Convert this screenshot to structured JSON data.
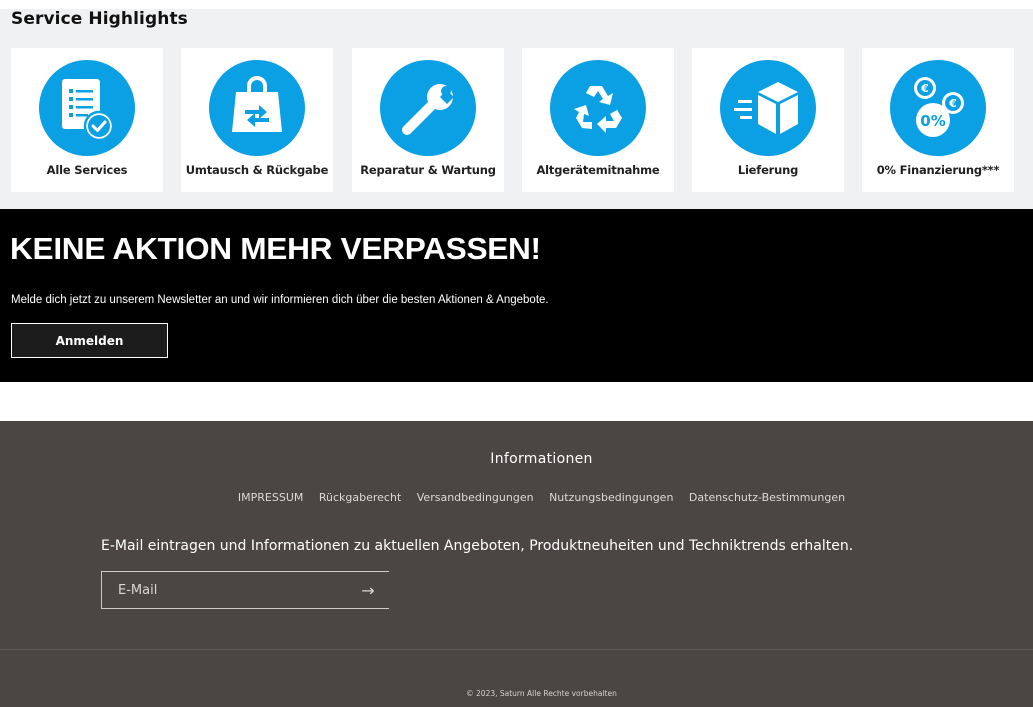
{
  "service": {
    "title": "Service Highlights",
    "cards": [
      {
        "label": "Alle Services",
        "icon": "document-check-icon"
      },
      {
        "label": "Umtausch & Rückgabe",
        "icon": "bag-exchange-icon"
      },
      {
        "label": "Reparatur & Wartung",
        "icon": "wrench-icon"
      },
      {
        "label": "Altgerätemitnahme",
        "icon": "recycle-icon"
      },
      {
        "label": "Lieferung",
        "icon": "delivery-box-icon"
      },
      {
        "label": "0% Finanzierung***",
        "icon": "financing-coins-icon"
      }
    ],
    "accent_color": "#0b9fe3"
  },
  "newsletter": {
    "heading": "KEINE AKTION MEHR VERPASSEN!",
    "text": "Melde dich jetzt zu unserem Newsletter an und wir informieren dich über die besten Aktionen & Angebote.",
    "button_label": "Anmelden"
  },
  "footer": {
    "info_heading": "Informationen",
    "links": [
      "IMPRESSUM",
      "Rückgaberecht",
      "Versandbedingungen",
      "Nutzungsbedingungen",
      "Datenschutz-Bestimmungen"
    ],
    "promo_text": "E-Mail eintragen und Informationen zu aktuellen Angeboten, Produktneuheiten und Techniktrends erhalten.",
    "email_placeholder": "E-Mail",
    "submit_icon": "arrow-right-icon",
    "copyright": "© 2023, Saturn Alle Rechte vorbehalten"
  }
}
